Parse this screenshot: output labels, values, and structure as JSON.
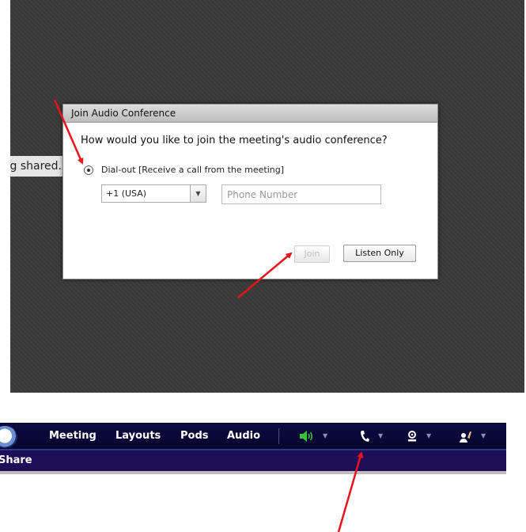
{
  "background": {
    "partial_text": "g shared."
  },
  "dialog": {
    "title": "Join Audio Conference",
    "question": "How would you like to join the meeting's audio conference?",
    "option_label": "Dial-out [Receive a call from the meeting]",
    "country_value": "+1 (USA)",
    "phone_placeholder": "Phone Number",
    "join_label": "Join",
    "listen_only_label": "Listen Only"
  },
  "menubar": {
    "items": [
      "Meeting",
      "Layouts",
      "Pods",
      "Audio"
    ],
    "icons": [
      "speaker-icon",
      "phone-icon",
      "webcam-icon",
      "raise-hand-icon"
    ],
    "speaker_color": "#3ac43a"
  },
  "subbar": {
    "label": "Share"
  },
  "annotation": {
    "arrow_color": "#e8141b"
  }
}
